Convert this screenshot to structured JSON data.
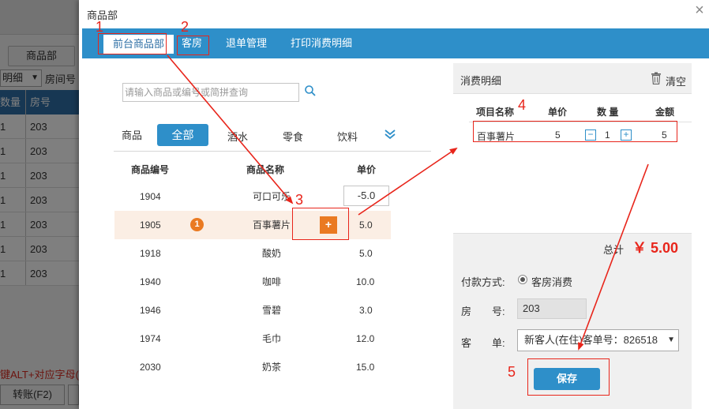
{
  "background": {
    "tab_label": "商品部",
    "select_value": "明细",
    "room_label": "房间号",
    "grid_headers": [
      "数量",
      "房号"
    ],
    "grid_rows": [
      {
        "qty": "1",
        "room": "203"
      },
      {
        "qty": "1",
        "room": "203"
      },
      {
        "qty": "1",
        "room": "203"
      },
      {
        "qty": "1",
        "room": "203"
      },
      {
        "qty": "1",
        "room": "203"
      },
      {
        "qty": "1",
        "room": "203"
      },
      {
        "qty": "1",
        "room": "203"
      }
    ],
    "hint": "键ALT+对应字母(1",
    "transfer_button": "转账(F2)"
  },
  "dialog": {
    "title": "商品部",
    "close_icon": "close-icon",
    "tabs": [
      "前台商品部",
      "客房",
      "退单管理",
      "打印消费明细"
    ],
    "active_tab": 0
  },
  "left": {
    "search_placeholder": "请输入商品或编号或简拼查询",
    "category_label": "商品",
    "categories": [
      "全部",
      "酒水",
      "零食",
      "饮料"
    ],
    "columns": [
      "商品编号",
      "商品名称",
      "单价"
    ],
    "products": [
      {
        "code": "1904",
        "name": "可口可乐",
        "price": "-5.0"
      },
      {
        "code": "1905",
        "name": "百事薯片",
        "price": "5.0",
        "badge": "1",
        "add": "+"
      },
      {
        "code": "1918",
        "name": "酸奶",
        "price": "5.0"
      },
      {
        "code": "1940",
        "name": "咖啡",
        "price": "10.0"
      },
      {
        "code": "1946",
        "name": "雪碧",
        "price": "3.0"
      },
      {
        "code": "1974",
        "name": "毛巾",
        "price": "12.0"
      },
      {
        "code": "2030",
        "name": "奶茶",
        "price": "15.0"
      }
    ]
  },
  "right": {
    "title": "消费明细",
    "clear_label": "清空",
    "columns": [
      "项目名称",
      "单价",
      "数 量",
      "金额"
    ],
    "items": [
      {
        "name": "百事薯片",
        "price": "5",
        "qty": "1",
        "amount": "5",
        "minus": "−",
        "plus": "+"
      }
    ],
    "total_label": "总计",
    "total_value": "￥ 5.00",
    "payment_label": "付款方式:",
    "payment_option": "客房消费",
    "room_label": "房　　号:",
    "room_value": "203",
    "guest_label": "客　　单:",
    "guest_value": "新客人(在住)客单号：826518",
    "save_label": "保存"
  },
  "annotations": [
    "1",
    "2",
    "3",
    "4",
    "5"
  ],
  "colors": {
    "accent": "#2e8fc9",
    "highlight": "#e8251b",
    "add_button": "#ea7a22",
    "row_selected": "#fbeee4"
  }
}
